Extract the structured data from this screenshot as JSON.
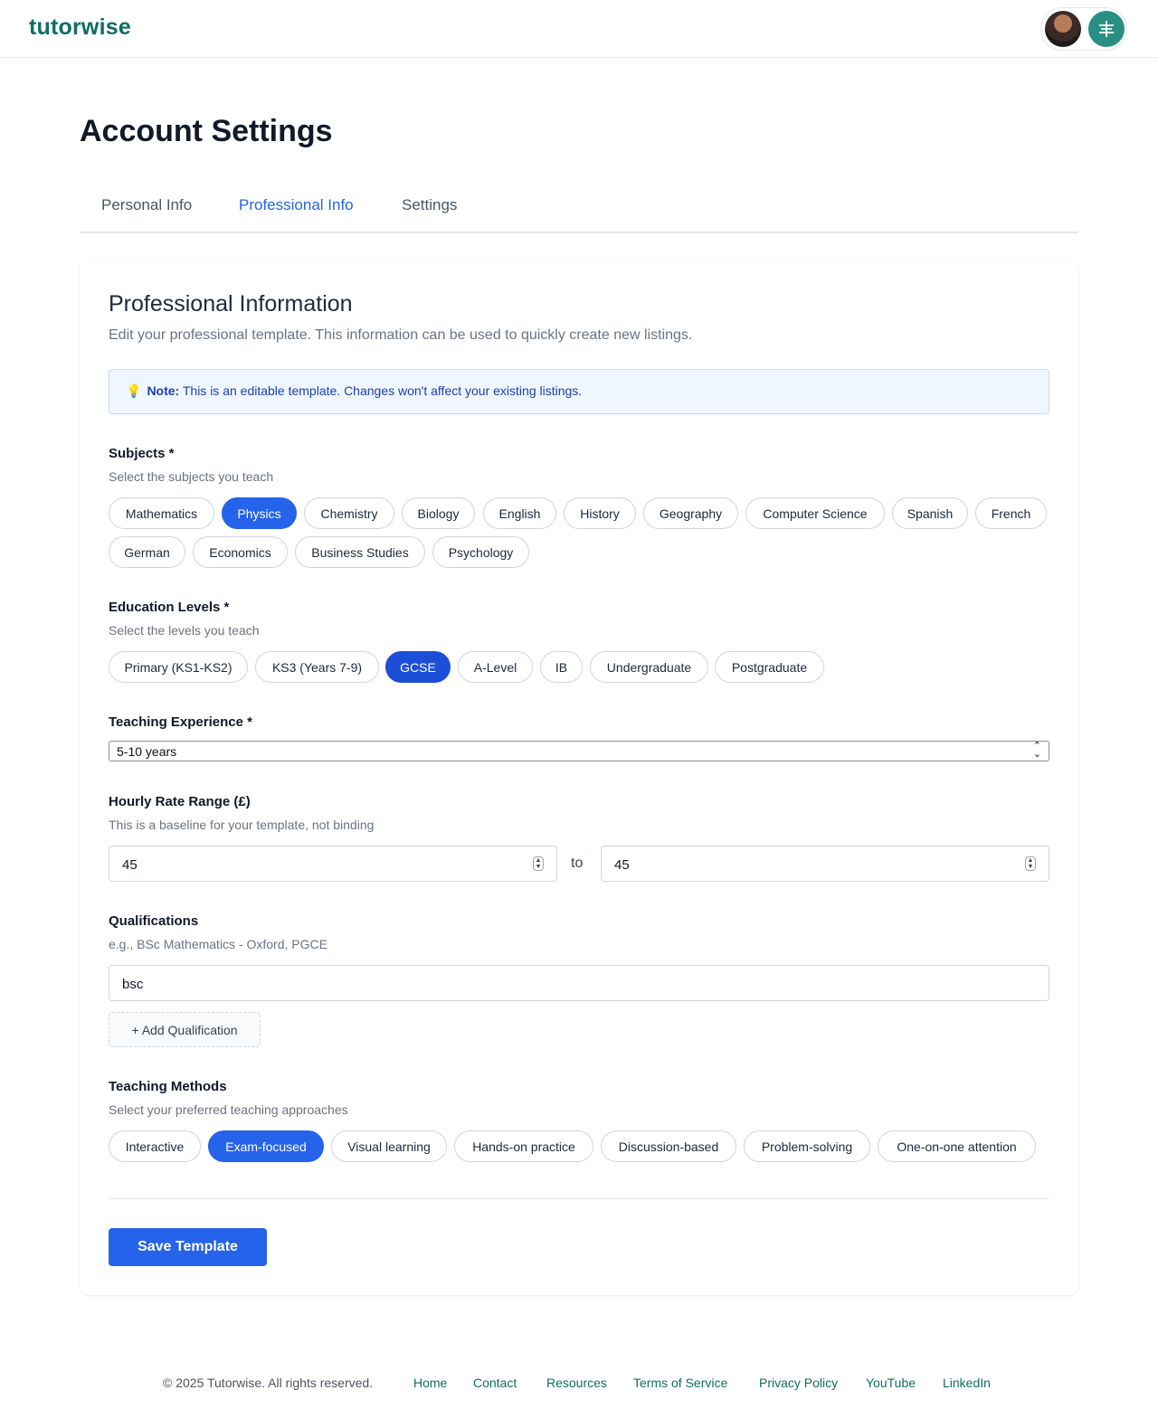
{
  "header": {
    "logo": "tutorwise",
    "brand_accent": "#0f6e62"
  },
  "page": {
    "title": "Account Settings",
    "tabs": [
      {
        "label": "Personal Info",
        "active": false
      },
      {
        "label": "Professional Info",
        "active": true
      },
      {
        "label": "Settings",
        "active": false
      }
    ]
  },
  "card": {
    "title": "Professional Information",
    "subtitle": "Edit your professional template. This information can be used to quickly create new listings.",
    "note_icon": "lightbulb-icon",
    "note_label": "Note:",
    "note_text": "This is an editable template. Changes won't affect your existing listings."
  },
  "subjects": {
    "label": "Subjects *",
    "hint": "Select the subjects you teach",
    "options": [
      "Mathematics",
      "Physics",
      "Chemistry",
      "Biology",
      "English",
      "History",
      "Geography",
      "Computer Science",
      "Spanish",
      "French",
      "German",
      "Economics",
      "Business Studies",
      "Psychology"
    ],
    "selected": [
      "Physics"
    ]
  },
  "levels": {
    "label": "Education Levels *",
    "hint": "Select the levels you teach",
    "options": [
      "Primary (KS1-KS2)",
      "KS3 (Years 7-9)",
      "GCSE",
      "A-Level",
      "IB",
      "Undergraduate",
      "Postgraduate"
    ],
    "selected": [
      "GCSE"
    ]
  },
  "experience": {
    "label": "Teaching Experience *",
    "value": "5-10 years"
  },
  "rate": {
    "label": "Hourly Rate Range (£)",
    "hint": "This is a baseline for your template, not binding",
    "min": "45",
    "separator": "to",
    "max": "45"
  },
  "qualifications": {
    "label": "Qualifications",
    "hint": "e.g., BSc Mathematics - Oxford, PGCE",
    "value": "bsc",
    "add_label": "+ Add Qualification"
  },
  "methods": {
    "label": "Teaching Methods",
    "hint": "Select your preferred teaching approaches",
    "options": [
      "Interactive",
      "Exam-focused",
      "Visual learning",
      "Hands-on practice",
      "Discussion-based",
      "Problem-solving",
      "One-on-one attention"
    ],
    "selected": [
      "Exam-focused"
    ]
  },
  "actions": {
    "save_label": "Save Template",
    "primary_color": "#2563eb"
  },
  "footer": {
    "copyright": "© 2025 Tutorwise. All rights reserved.",
    "links": [
      "Home",
      "Contact",
      "Resources",
      "Terms of Service",
      "Privacy Policy",
      "YouTube",
      "LinkedIn"
    ]
  }
}
